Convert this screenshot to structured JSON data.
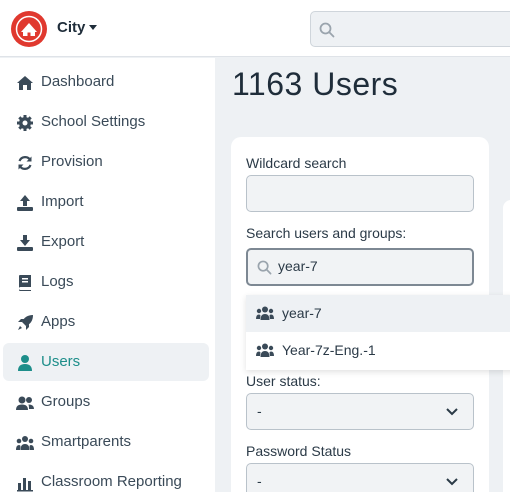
{
  "header": {
    "org_name": "City",
    "search_placeholder": ""
  },
  "sidebar": {
    "items": [
      {
        "label": "Dashboard",
        "icon": "home-icon",
        "active": false
      },
      {
        "label": "School Settings",
        "icon": "gear-icon",
        "active": false
      },
      {
        "label": "Provision",
        "icon": "sync-icon",
        "active": false
      },
      {
        "label": "Import",
        "icon": "upload-icon",
        "active": false
      },
      {
        "label": "Export",
        "icon": "download-icon",
        "active": false
      },
      {
        "label": "Logs",
        "icon": "book-icon",
        "active": false
      },
      {
        "label": "Apps",
        "icon": "rocket-icon",
        "active": false
      },
      {
        "label": "Users",
        "icon": "user-icon",
        "active": true
      },
      {
        "label": "Groups",
        "icon": "user-group-icon",
        "active": false
      },
      {
        "label": "Smartparents",
        "icon": "people-icon",
        "active": false
      },
      {
        "label": "Classroom Reporting",
        "icon": "bar-chart-icon",
        "active": false
      }
    ]
  },
  "main": {
    "title": "1163 Users",
    "filters": {
      "wildcard_label": "Wildcard search",
      "wildcard_value": "",
      "search_label": "Search users and groups:",
      "search_value": "year-7",
      "suggestions": [
        "year-7",
        "Year-7z-Eng.-1"
      ],
      "status_label": "User status:",
      "status_value": "-",
      "password_label": "Password Status",
      "password_value": "-"
    }
  },
  "colors": {
    "accent": "#1d8e8a",
    "logo": "#e0392f",
    "background": "#eef1f4"
  }
}
